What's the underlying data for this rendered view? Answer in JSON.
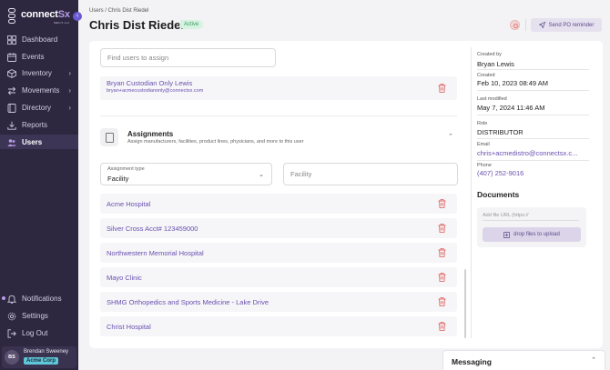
{
  "app": {
    "logo_main": "connect",
    "logo_accent": "Sx",
    "logo_sub": "MED-IT, LLC"
  },
  "sidebar": {
    "items": [
      {
        "label": "Dashboard",
        "icon": "grid-icon",
        "has_chevron": false
      },
      {
        "label": "Events",
        "icon": "calendar-icon",
        "has_chevron": false
      },
      {
        "label": "Inventory",
        "icon": "box-icon",
        "has_chevron": true
      },
      {
        "label": "Movements",
        "icon": "arrows-icon",
        "has_chevron": true
      },
      {
        "label": "Directory",
        "icon": "book-icon",
        "has_chevron": true
      },
      {
        "label": "Reports",
        "icon": "download-icon",
        "has_chevron": false
      },
      {
        "label": "Users",
        "icon": "users-icon",
        "has_chevron": false,
        "active": true
      }
    ],
    "bottom_items": [
      {
        "label": "Notifications",
        "icon": "bell-icon"
      },
      {
        "label": "Settings",
        "icon": "gear-icon"
      },
      {
        "label": "Log Out",
        "icon": "logout-icon"
      }
    ],
    "user": {
      "initials": "BS",
      "name": "Brendan Sweeney",
      "org": "Acme Corp"
    }
  },
  "header": {
    "breadcrumb": "Users / Chris Dist Riedel",
    "title": "Chris Dist Riedel",
    "status": "Active",
    "send_po_label": "Send PO reminder"
  },
  "users_section": {
    "search_placeholder": "Find users to assign",
    "assigned_user": {
      "name": "Bryan Custodian Only Lewis",
      "email": "bryan+acmecustodianonly@connectsx.com"
    }
  },
  "assignments": {
    "title": "Assignments",
    "subtitle": "Assign manufacturers, facilities, product lines, physicians, and more to this user",
    "type_label": "Assignment type",
    "type_value": "Facility",
    "facility_placeholder": "Facility",
    "rows": [
      "Acme Hospital",
      "Silver Cross Acct# 123459000",
      "Northwestern Memorial Hospital",
      "Mayo Clinic",
      "SHMG Orthopedics and Sports Medicine - Lake Drive",
      "Christ Hospital"
    ]
  },
  "details": {
    "created_by_label": "Created by",
    "created_by": "Bryan Lewis",
    "created_label": "Created",
    "created": "Feb 10, 2023 08:49 AM",
    "modified_label": "Last modified",
    "modified": "May 7, 2024 11:46 AM",
    "role_label": "Role",
    "role": "DISTRIBUTOR",
    "email_label": "Email",
    "email": "chris+acmedistro@connectsx.c...",
    "phone_label": "Phone",
    "phone": "(407) 252-9016"
  },
  "documents": {
    "title": "Documents",
    "url_placeholder": "Add file URL (https://",
    "drop_label": "drop files to upload"
  },
  "messaging": {
    "title": "Messaging"
  },
  "colors": {
    "sidebar": "#2d2740",
    "accent": "#6a4fb0",
    "delete": "#e06b6b",
    "active_badge": "#d6f2e1"
  }
}
